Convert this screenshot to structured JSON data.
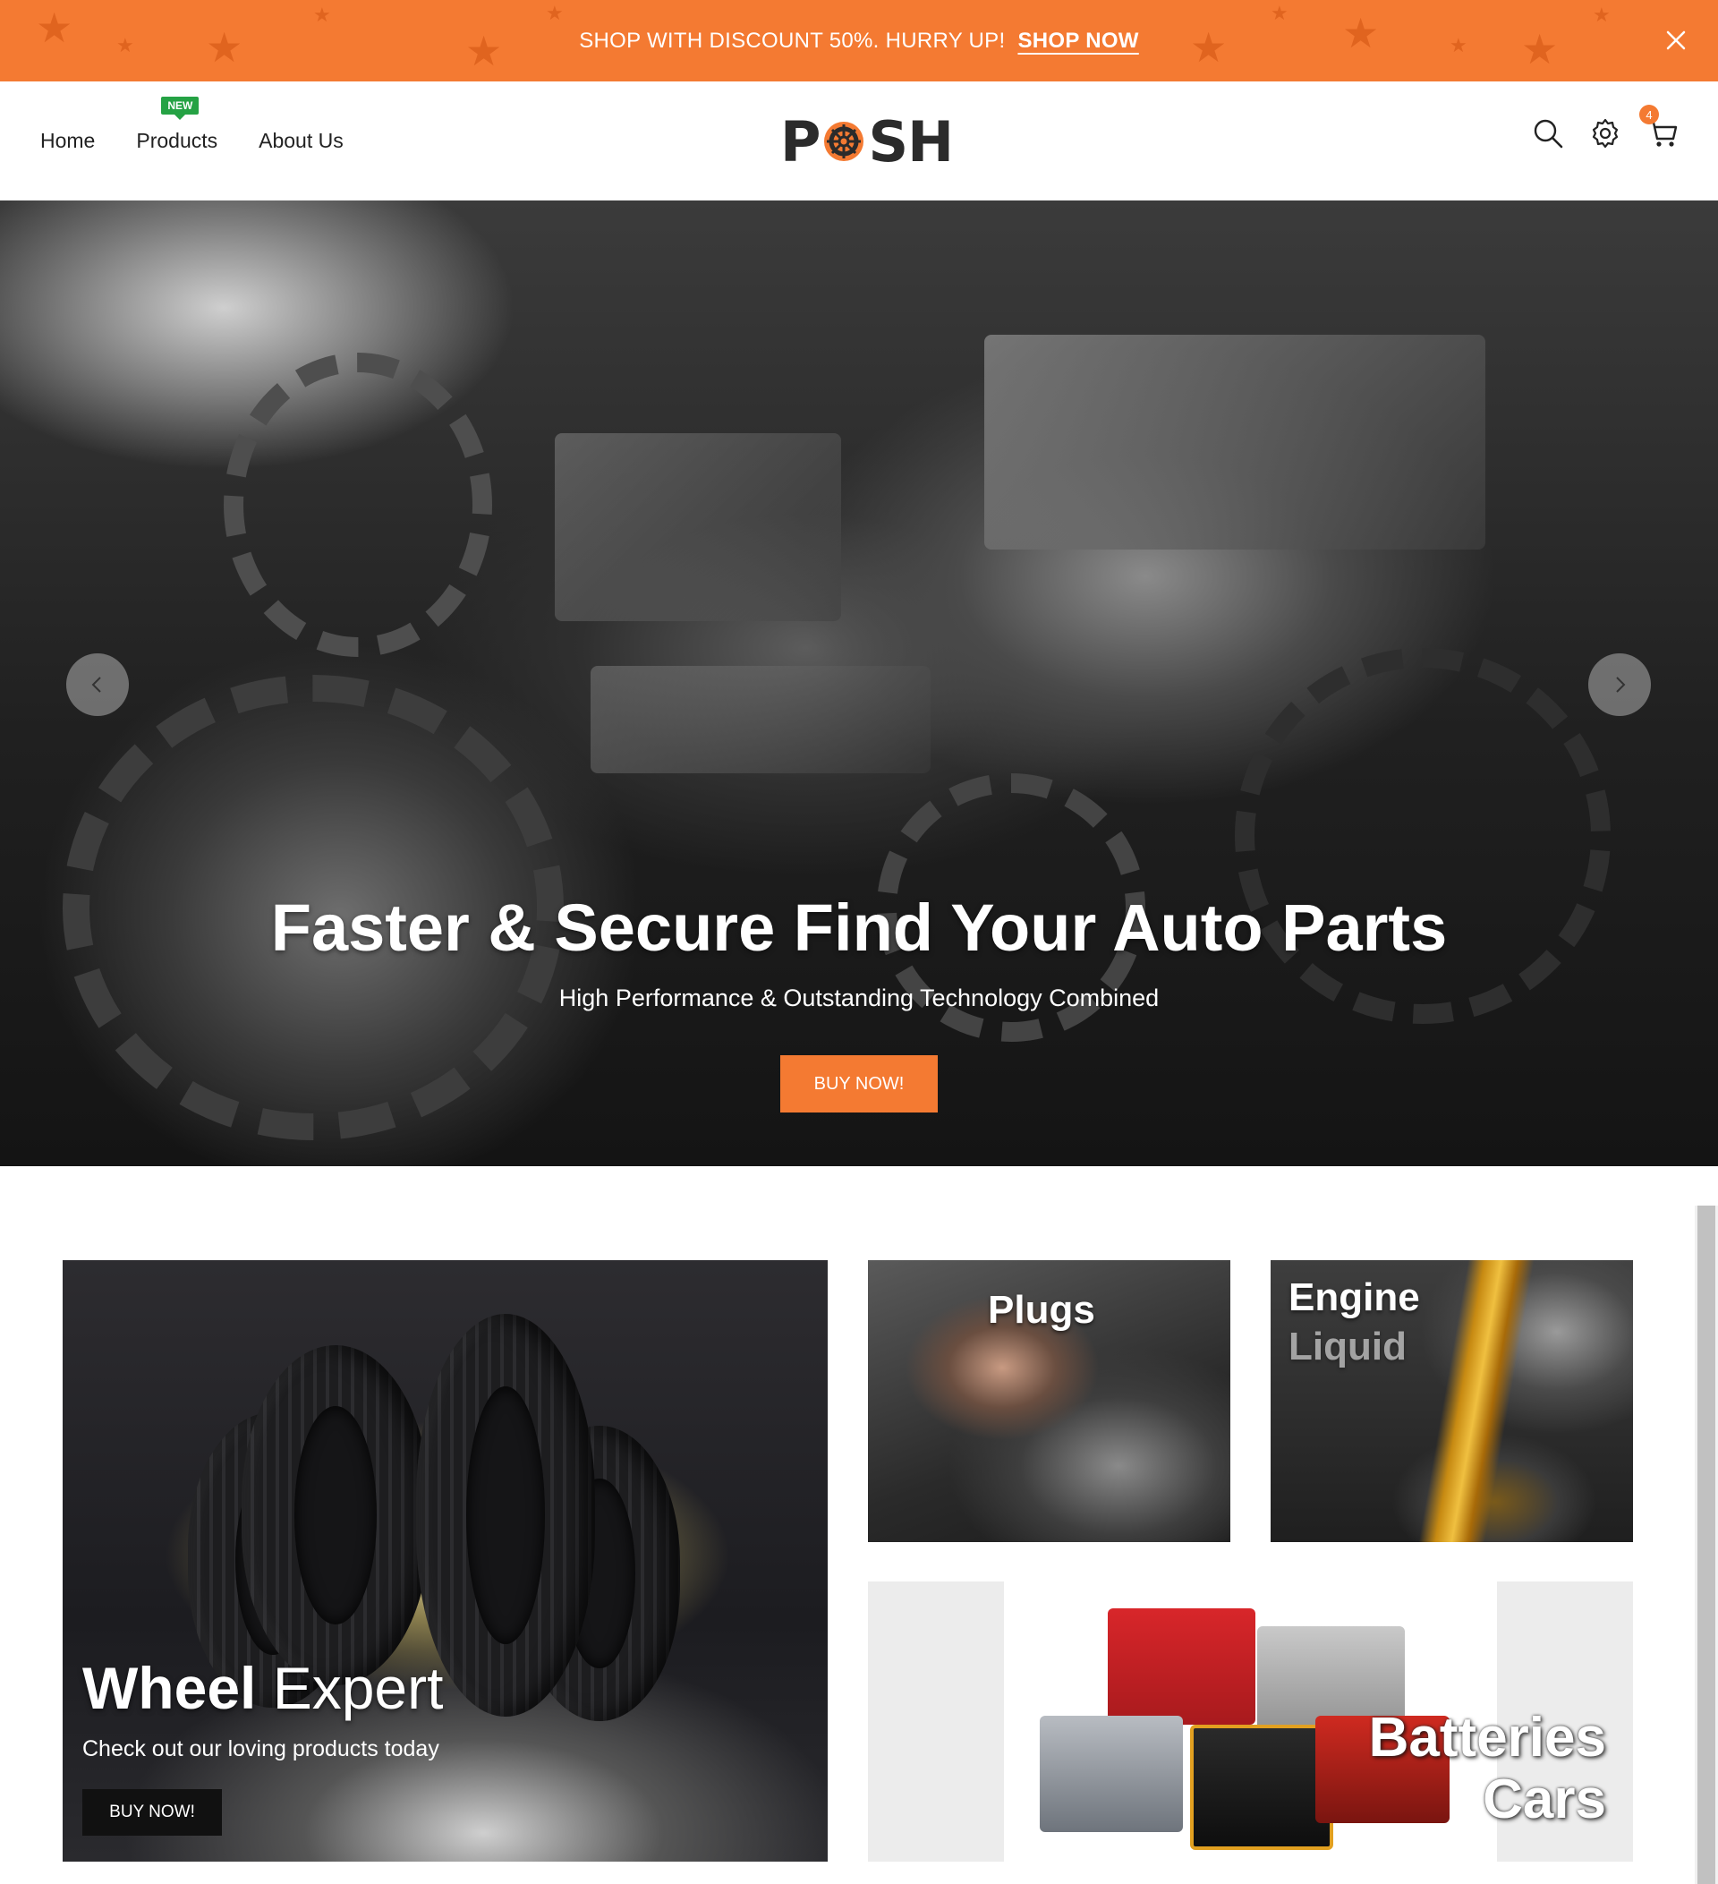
{
  "announcement": {
    "text": "SHOP WITH DISCOUNT 50%. HURRY UP!",
    "link": "SHOP NOW",
    "bg_color": "#f47a32"
  },
  "header": {
    "nav": [
      {
        "label": "Home"
      },
      {
        "label": "Products",
        "badge": "NEW"
      },
      {
        "label": "About Us"
      }
    ],
    "logo": "POSH",
    "icons": [
      "search-icon",
      "settings-gear-icon",
      "cart-icon"
    ],
    "cart_count": "4"
  },
  "hero": {
    "title": "Faster & Secure Find Your Auto Parts",
    "subtitle": "High Performance & Outstanding Technology Combined",
    "button": "BUY NOW!"
  },
  "banners": {
    "wheel": {
      "title_bold": "Wheel",
      "title_light": "Expert",
      "subtitle": "Check out our loving products today",
      "button": "BUY NOW!"
    },
    "plugs": {
      "title": "Plugs"
    },
    "engine": {
      "title_line1": "Engine",
      "title_line2": "Liquid"
    },
    "batteries": {
      "title_line1": "Batteries",
      "title_line2": "Cars"
    }
  },
  "colors": {
    "accent": "#f47a32",
    "badge_green": "#25a244",
    "text_dark": "#222222"
  }
}
